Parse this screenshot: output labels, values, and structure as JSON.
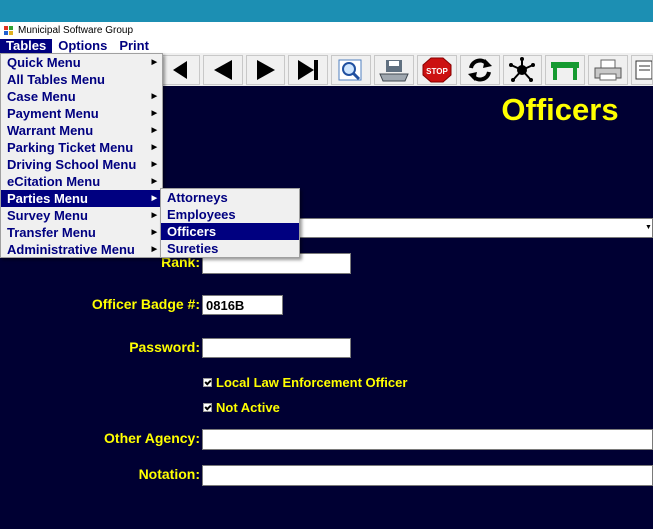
{
  "window": {
    "title": "Municipal Software Group"
  },
  "menubar": {
    "items": [
      {
        "label": "Tables"
      },
      {
        "label": "Options"
      },
      {
        "label": "Print"
      }
    ]
  },
  "tables_menu": {
    "items": [
      {
        "label": "Quick Menu",
        "has_submenu": true
      },
      {
        "label": "All Tables Menu",
        "has_submenu": false
      },
      {
        "label": "Case Menu",
        "has_submenu": true
      },
      {
        "label": "Payment Menu",
        "has_submenu": true
      },
      {
        "label": "Warrant Menu",
        "has_submenu": true
      },
      {
        "label": "Parking Ticket Menu",
        "has_submenu": true
      },
      {
        "label": "Driving School Menu",
        "has_submenu": true
      },
      {
        "label": "eCitation Menu",
        "has_submenu": true
      },
      {
        "label": "Parties Menu",
        "has_submenu": true
      },
      {
        "label": "Survey Menu",
        "has_submenu": true
      },
      {
        "label": "Transfer Menu",
        "has_submenu": true
      },
      {
        "label": "Administrative Menu",
        "has_submenu": true
      }
    ],
    "active_index": 8
  },
  "parties_submenu": {
    "items": [
      {
        "label": "Attorneys"
      },
      {
        "label": "Employees"
      },
      {
        "label": "Officers"
      },
      {
        "label": "Sureties"
      }
    ],
    "active_index": 2
  },
  "toolbar": {
    "buttons": [
      "first-record-icon",
      "previous-record-icon",
      "next-record-icon",
      "last-record-icon",
      "find-icon",
      "save-icon",
      "stop-icon",
      "refresh-icon",
      "network-icon",
      "table-icon",
      "printer-icon",
      "export-icon"
    ],
    "stop_label": "STOP"
  },
  "form": {
    "title": "Officers",
    "rank": {
      "label": "Rank:",
      "value": ""
    },
    "badge": {
      "label": "Officer Badge #:",
      "value": "0816B"
    },
    "password": {
      "label": "Password:",
      "value": ""
    },
    "local_officer": {
      "label": "Local Law Enforcement Officer",
      "checked": true
    },
    "not_active": {
      "label": "Not Active",
      "checked": true
    },
    "other_agency": {
      "label": "Other Agency:",
      "value": ""
    },
    "notation": {
      "label": "Notation:",
      "value": ""
    }
  },
  "colors": {
    "background": "#000033",
    "label": "#ffff00",
    "menu_text": "#000080",
    "menu_highlight": "#000080"
  }
}
